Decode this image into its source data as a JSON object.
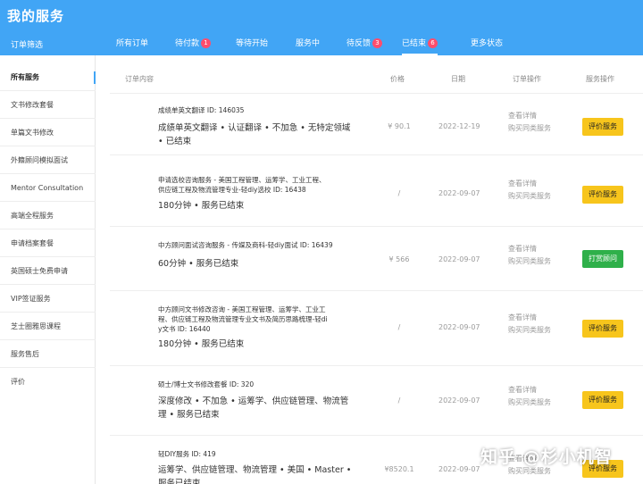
{
  "header": {
    "title": "我的服务",
    "filter_label": "订单筛选",
    "tabs": [
      {
        "label": "所有订单",
        "badge": null
      },
      {
        "label": "待付款",
        "badge": "1"
      },
      {
        "label": "等待开始",
        "badge": null
      },
      {
        "label": "服务中",
        "badge": null
      },
      {
        "label": "待反馈",
        "badge": "3"
      },
      {
        "label": "已结束",
        "badge": "6"
      },
      {
        "label": "更多状态",
        "badge": null
      }
    ],
    "active_tab": "已结束"
  },
  "sidebar": {
    "items": [
      {
        "label": "所有服务"
      },
      {
        "label": "文书修改套餐"
      },
      {
        "label": "单篇文书修改"
      },
      {
        "label": "外籍顾问模拟面试"
      },
      {
        "label": "Mentor Consultation"
      },
      {
        "label": "高端全程服务"
      },
      {
        "label": "申请档案套餐"
      },
      {
        "label": "英国硕士免费申请"
      },
      {
        "label": "VIP签证服务"
      },
      {
        "label": "芝士圈雅思课程"
      },
      {
        "label": "服务售后"
      },
      {
        "label": "评价"
      }
    ],
    "active": "所有服务"
  },
  "table": {
    "headers": {
      "content": "订单内容",
      "price": "价格",
      "date": "日期",
      "order_op": "订单操作",
      "service_op": "服务操作"
    },
    "rows": [
      {
        "name_lines": [
          "成绩单英文翻译 ID: 146035"
        ],
        "desc_lines": [
          "成绩单英文翻译 • 认证翻译 • 不加急 • 无特定领域",
          "• 已结束"
        ],
        "price": "¥ 90.1",
        "date": "2022-12-19",
        "ops": [
          "查看详情",
          "购买同类服务"
        ],
        "action": "评价服务",
        "action_style": "yellow"
      },
      {
        "name_lines": [
          "申请选校咨询服务 - 美国工程管理、运筹学、工业工程、",
          "供应链工程及物流管理专业-轻diy选校 ID: 16438"
        ],
        "desc_lines": [
          "180分钟 • 服务已结束"
        ],
        "price": "/",
        "date": "2022-09-07",
        "ops": [
          "查看详情",
          "购买同类服务"
        ],
        "action": "评价服务",
        "action_style": "yellow"
      },
      {
        "name_lines": [
          "中方顾问面试咨询服务 - 传媒及商科-轻diy面试 ID: 16439"
        ],
        "desc_lines": [
          "60分钟 • 服务已结束"
        ],
        "price": "¥ 566",
        "date": "2022-09-07",
        "ops": [
          "查看详情",
          "购买同类服务"
        ],
        "action": "打赏顾问",
        "action_style": "green"
      },
      {
        "name_lines": [
          "中方顾问文书修改咨询 - 美国工程管理、运筹学、工业工",
          "程、供应链工程及物流管理专业文书及简历思路梳理-轻di",
          "y文书 ID: 16440"
        ],
        "desc_lines": [
          "180分钟 • 服务已结束"
        ],
        "price": "/",
        "date": "2022-09-07",
        "ops": [
          "查看详情",
          "购买同类服务"
        ],
        "action": "评价服务",
        "action_style": "yellow"
      },
      {
        "name_lines": [
          "硕士/博士文书修改套餐 ID: 320"
        ],
        "desc_lines": [
          "深度修改 • 不加急 • 运筹学、供应链管理、物流管",
          "理 • 服务已结束"
        ],
        "price": "/",
        "date": "2022-09-07",
        "ops": [
          "查看详情",
          "购买同类服务"
        ],
        "action": "评价服务",
        "action_style": "yellow"
      },
      {
        "name_lines": [
          "轻DIY服务 ID: 419"
        ],
        "desc_lines": [
          "运筹学、供应链管理、物流管理 • 美国 • Master •",
          "服务已结束"
        ],
        "price": "¥8520.1",
        "date": "2022-09-07",
        "ops": [
          "查看详情",
          "购买同类服务"
        ],
        "action": "评价服务",
        "action_style": "yellow"
      }
    ]
  },
  "watermark": "知乎 @杉小机智"
}
